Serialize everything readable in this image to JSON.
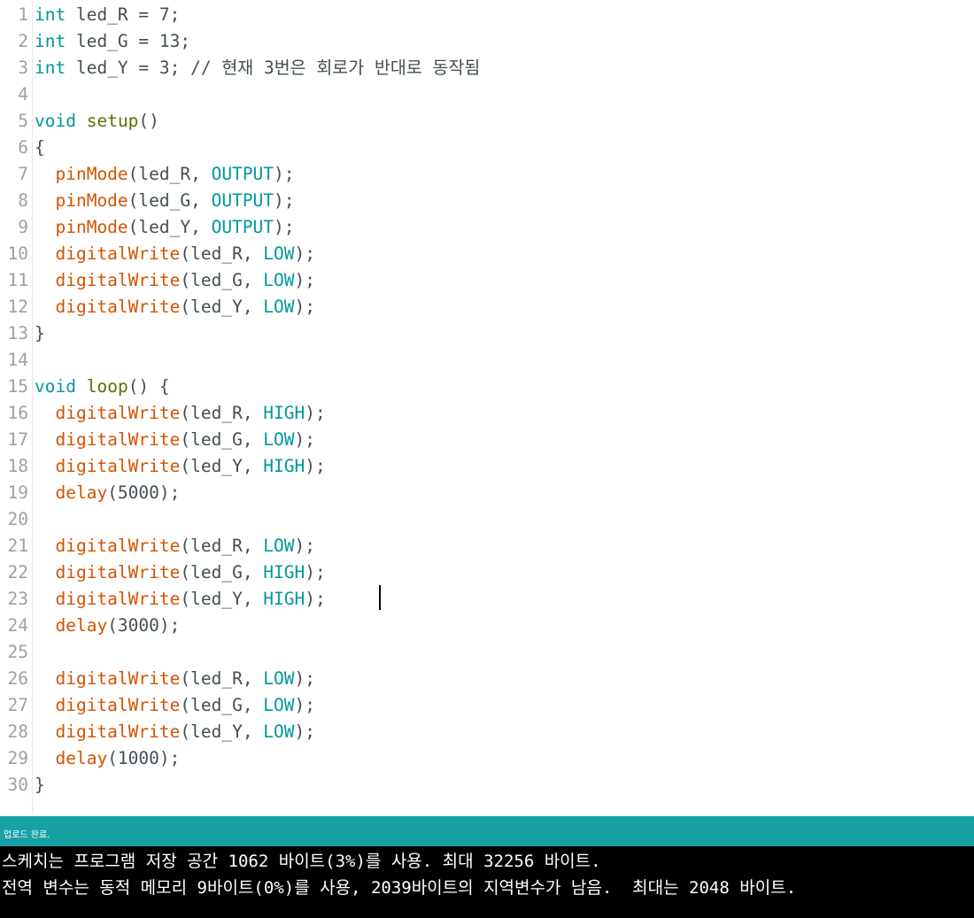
{
  "editor": {
    "cursor_line": 23,
    "lines": [
      {
        "n": "1",
        "tokens": [
          {
            "t": "int",
            "c": "kw"
          },
          {
            "t": " led_R = 7;",
            "c": "txt"
          }
        ]
      },
      {
        "n": "2",
        "tokens": [
          {
            "t": "int",
            "c": "kw"
          },
          {
            "t": " led_G = 13;",
            "c": "txt"
          }
        ]
      },
      {
        "n": "3",
        "tokens": [
          {
            "t": "int",
            "c": "kw"
          },
          {
            "t": " led_Y = 3; // 현재 3번은 회로가 반대로 동작됨",
            "c": "txt"
          }
        ]
      },
      {
        "n": "4",
        "tokens": []
      },
      {
        "n": "5",
        "tokens": [
          {
            "t": "void",
            "c": "kw"
          },
          {
            "t": " ",
            "c": "txt"
          },
          {
            "t": "setup",
            "c": "sfn"
          },
          {
            "t": "()",
            "c": "txt"
          }
        ]
      },
      {
        "n": "6",
        "tokens": [
          {
            "t": "{",
            "c": "txt"
          }
        ]
      },
      {
        "n": "7",
        "tokens": [
          {
            "t": "  ",
            "c": "txt"
          },
          {
            "t": "pinMode",
            "c": "fn"
          },
          {
            "t": "(led_R, ",
            "c": "txt"
          },
          {
            "t": "OUTPUT",
            "c": "kw"
          },
          {
            "t": ");",
            "c": "txt"
          }
        ]
      },
      {
        "n": "8",
        "tokens": [
          {
            "t": "  ",
            "c": "txt"
          },
          {
            "t": "pinMode",
            "c": "fn"
          },
          {
            "t": "(led_G, ",
            "c": "txt"
          },
          {
            "t": "OUTPUT",
            "c": "kw"
          },
          {
            "t": ");",
            "c": "txt"
          }
        ]
      },
      {
        "n": "9",
        "tokens": [
          {
            "t": "  ",
            "c": "txt"
          },
          {
            "t": "pinMode",
            "c": "fn"
          },
          {
            "t": "(led_Y, ",
            "c": "txt"
          },
          {
            "t": "OUTPUT",
            "c": "kw"
          },
          {
            "t": ");",
            "c": "txt"
          }
        ]
      },
      {
        "n": "10",
        "tokens": [
          {
            "t": "  ",
            "c": "txt"
          },
          {
            "t": "digitalWrite",
            "c": "fn"
          },
          {
            "t": "(led_R, ",
            "c": "txt"
          },
          {
            "t": "LOW",
            "c": "kw"
          },
          {
            "t": ");",
            "c": "txt"
          }
        ]
      },
      {
        "n": "11",
        "tokens": [
          {
            "t": "  ",
            "c": "txt"
          },
          {
            "t": "digitalWrite",
            "c": "fn"
          },
          {
            "t": "(led_G, ",
            "c": "txt"
          },
          {
            "t": "LOW",
            "c": "kw"
          },
          {
            "t": ");",
            "c": "txt"
          }
        ]
      },
      {
        "n": "12",
        "tokens": [
          {
            "t": "  ",
            "c": "txt"
          },
          {
            "t": "digitalWrite",
            "c": "fn"
          },
          {
            "t": "(led_Y, ",
            "c": "txt"
          },
          {
            "t": "LOW",
            "c": "kw"
          },
          {
            "t": ");",
            "c": "txt"
          }
        ]
      },
      {
        "n": "13",
        "tokens": [
          {
            "t": "}",
            "c": "txt"
          }
        ]
      },
      {
        "n": "14",
        "tokens": []
      },
      {
        "n": "15",
        "tokens": [
          {
            "t": "void",
            "c": "kw"
          },
          {
            "t": " ",
            "c": "txt"
          },
          {
            "t": "loop",
            "c": "sfn"
          },
          {
            "t": "() {",
            "c": "txt"
          }
        ]
      },
      {
        "n": "16",
        "tokens": [
          {
            "t": "  ",
            "c": "txt"
          },
          {
            "t": "digitalWrite",
            "c": "fn"
          },
          {
            "t": "(led_R, ",
            "c": "txt"
          },
          {
            "t": "HIGH",
            "c": "kw"
          },
          {
            "t": ");",
            "c": "txt"
          }
        ]
      },
      {
        "n": "17",
        "tokens": [
          {
            "t": "  ",
            "c": "txt"
          },
          {
            "t": "digitalWrite",
            "c": "fn"
          },
          {
            "t": "(led_G, ",
            "c": "txt"
          },
          {
            "t": "LOW",
            "c": "kw"
          },
          {
            "t": ");",
            "c": "txt"
          }
        ]
      },
      {
        "n": "18",
        "tokens": [
          {
            "t": "  ",
            "c": "txt"
          },
          {
            "t": "digitalWrite",
            "c": "fn"
          },
          {
            "t": "(led_Y, ",
            "c": "txt"
          },
          {
            "t": "HIGH",
            "c": "kw"
          },
          {
            "t": ");",
            "c": "txt"
          }
        ]
      },
      {
        "n": "19",
        "tokens": [
          {
            "t": "  ",
            "c": "txt"
          },
          {
            "t": "delay",
            "c": "fn"
          },
          {
            "t": "(5000);",
            "c": "txt"
          }
        ]
      },
      {
        "n": "20",
        "tokens": []
      },
      {
        "n": "21",
        "tokens": [
          {
            "t": "  ",
            "c": "txt"
          },
          {
            "t": "digitalWrite",
            "c": "fn"
          },
          {
            "t": "(led_R, ",
            "c": "txt"
          },
          {
            "t": "LOW",
            "c": "kw"
          },
          {
            "t": ");",
            "c": "txt"
          }
        ]
      },
      {
        "n": "22",
        "tokens": [
          {
            "t": "  ",
            "c": "txt"
          },
          {
            "t": "digitalWrite",
            "c": "fn"
          },
          {
            "t": "(led_G, ",
            "c": "txt"
          },
          {
            "t": "HIGH",
            "c": "kw"
          },
          {
            "t": ");",
            "c": "txt"
          }
        ]
      },
      {
        "n": "23",
        "tokens": [
          {
            "t": "  ",
            "c": "txt"
          },
          {
            "t": "digitalWrite",
            "c": "fn"
          },
          {
            "t": "(led_Y, ",
            "c": "txt"
          },
          {
            "t": "HIGH",
            "c": "kw"
          },
          {
            "t": ");",
            "c": "txt"
          }
        ]
      },
      {
        "n": "24",
        "tokens": [
          {
            "t": "  ",
            "c": "txt"
          },
          {
            "t": "delay",
            "c": "fn"
          },
          {
            "t": "(3000);",
            "c": "txt"
          }
        ]
      },
      {
        "n": "25",
        "tokens": []
      },
      {
        "n": "26",
        "tokens": [
          {
            "t": "  ",
            "c": "txt"
          },
          {
            "t": "digitalWrite",
            "c": "fn"
          },
          {
            "t": "(led_R, ",
            "c": "txt"
          },
          {
            "t": "LOW",
            "c": "kw"
          },
          {
            "t": ");",
            "c": "txt"
          }
        ]
      },
      {
        "n": "27",
        "tokens": [
          {
            "t": "  ",
            "c": "txt"
          },
          {
            "t": "digitalWrite",
            "c": "fn"
          },
          {
            "t": "(led_G, ",
            "c": "txt"
          },
          {
            "t": "LOW",
            "c": "kw"
          },
          {
            "t": ");",
            "c": "txt"
          }
        ]
      },
      {
        "n": "28",
        "tokens": [
          {
            "t": "  ",
            "c": "txt"
          },
          {
            "t": "digitalWrite",
            "c": "fn"
          },
          {
            "t": "(led_Y, ",
            "c": "txt"
          },
          {
            "t": "LOW",
            "c": "kw"
          },
          {
            "t": ");",
            "c": "txt"
          }
        ]
      },
      {
        "n": "29",
        "tokens": [
          {
            "t": "  ",
            "c": "txt"
          },
          {
            "t": "delay",
            "c": "fn"
          },
          {
            "t": "(1000);",
            "c": "txt"
          }
        ]
      },
      {
        "n": "30",
        "tokens": [
          {
            "t": "}",
            "c": "txt"
          }
        ]
      }
    ]
  },
  "status": {
    "message": "업로드 완료.",
    "color": "#17a1a5"
  },
  "console": {
    "lines": [
      "스케치는 프로그램 저장 공간 1062 바이트(3%)를 사용. 최대 32256 바이트.",
      "전역 변수는 동적 메모리 9바이트(0%)를 사용, 2039바이트의 지역변수가 남음.  최대는 2048 바이트."
    ]
  }
}
